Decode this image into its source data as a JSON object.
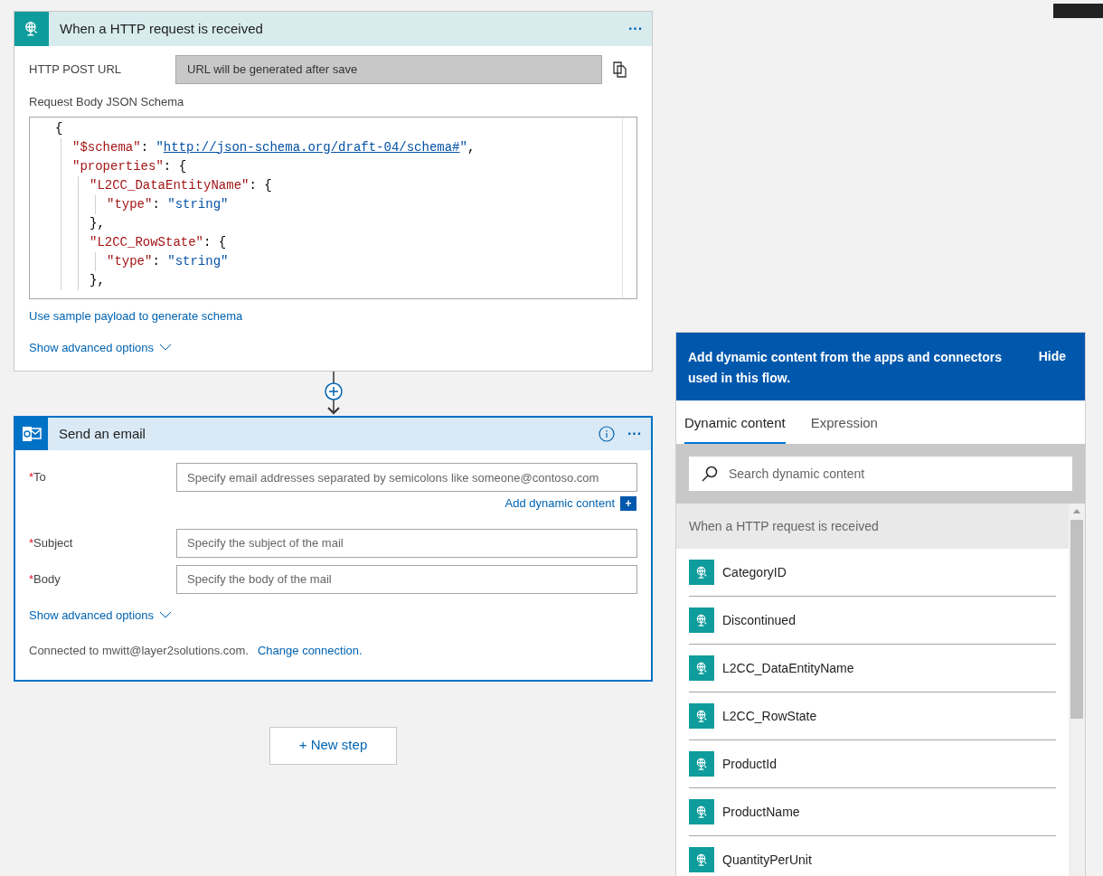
{
  "trigger": {
    "title": "When a HTTP request is received",
    "more": "···",
    "url_label": "HTTP POST URL",
    "url_value": "URL will be generated after save",
    "schema_label": "Request Body JSON Schema",
    "code": [
      {
        "segments": [
          {
            "kind": "punct",
            "text": "{"
          }
        ],
        "children": [
          {
            "segments": [
              {
                "kind": "key",
                "text": "\"$schema\""
              },
              {
                "kind": "punct",
                "text": ": "
              },
              {
                "kind": "string",
                "text": "\""
              },
              {
                "kind": "link",
                "text": "http://json-schema.org/draft-04/schema#"
              },
              {
                "kind": "string",
                "text": "\""
              },
              {
                "kind": "punct",
                "text": ","
              }
            ]
          },
          {
            "segments": [
              {
                "kind": "key",
                "text": "\"properties\""
              },
              {
                "kind": "punct",
                "text": ": {"
              }
            ],
            "children": [
              {
                "segments": [
                  {
                    "kind": "key",
                    "text": "\"L2CC_DataEntityName\""
                  },
                  {
                    "kind": "punct",
                    "text": ": {"
                  }
                ],
                "children": [
                  {
                    "segments": [
                      {
                        "kind": "key",
                        "text": "\"type\""
                      },
                      {
                        "kind": "punct",
                        "text": ": "
                      },
                      {
                        "kind": "string",
                        "text": "\"string\""
                      }
                    ]
                  }
                ]
              },
              {
                "segments": [
                  {
                    "kind": "punct",
                    "text": "},"
                  }
                ]
              },
              {
                "segments": [
                  {
                    "kind": "key",
                    "text": "\"L2CC_RowState\""
                  },
                  {
                    "kind": "punct",
                    "text": ": {"
                  }
                ],
                "children": [
                  {
                    "segments": [
                      {
                        "kind": "key",
                        "text": "\"type\""
                      },
                      {
                        "kind": "punct",
                        "text": ": "
                      },
                      {
                        "kind": "string",
                        "text": "\"string\""
                      }
                    ]
                  }
                ]
              },
              {
                "segments": [
                  {
                    "kind": "punct",
                    "text": "},"
                  }
                ]
              }
            ]
          }
        ]
      }
    ],
    "sample_link": "Use sample payload to generate schema",
    "advanced": "Show advanced options"
  },
  "email": {
    "title": "Send an email",
    "more": "···",
    "fields": [
      {
        "marker": "*",
        "label": "To",
        "placeholder": "Specify email addresses separated by semicolons like someone@contoso.com",
        "dynamic_link": "Add dynamic content",
        "dynamic_icon": "+"
      },
      {
        "marker": "*",
        "label": "Subject",
        "placeholder": "Specify the subject of the mail"
      },
      {
        "marker": "*",
        "label": "Body",
        "placeholder": "Specify the body of the mail"
      }
    ],
    "advanced": "Show advanced options",
    "connected": "Connected to mwitt@layer2solutions.com.",
    "change": "Change connection."
  },
  "new_step": "+ New step",
  "panel": {
    "message": "Add dynamic content from the apps and connectors used in this flow.",
    "hide": "Hide",
    "tabs": [
      {
        "label": "Dynamic content",
        "selected": true
      },
      {
        "label": "Expression",
        "selected": false
      }
    ],
    "search": {
      "placeholder": "Search dynamic content"
    },
    "section": "When a HTTP request is received",
    "items": [
      "CategoryID",
      "Discontinued",
      "L2CC_DataEntityName",
      "L2CC_RowState",
      "ProductId",
      "ProductName",
      "QuantityPerUnit"
    ]
  }
}
